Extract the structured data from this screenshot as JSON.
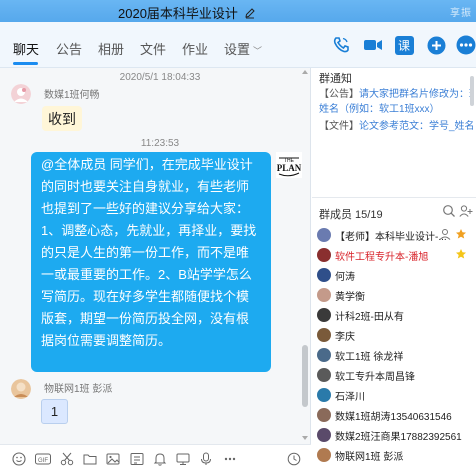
{
  "window": {
    "title": "2020届本科毕业设计",
    "top_right_faded": "享振"
  },
  "tabs": [
    {
      "label": "聊天",
      "active": true
    },
    {
      "label": "公告"
    },
    {
      "label": "相册"
    },
    {
      "label": "文件"
    },
    {
      "label": "作业"
    },
    {
      "label": "设置"
    }
  ],
  "toolbar": {
    "homework_icon_char": "课"
  },
  "chat": {
    "messages": [
      {
        "time": "2020/5/1 18:04:33",
        "sender": "数媒1班何畅",
        "text": "收到"
      },
      {
        "time": "11:23:53",
        "text": "@全体成员 同学们，在完成毕业设计的同时也要关注自身就业，有些老师也提到了一些好的建议分享给大家：1、调整心态，先就业，再择业，要找的只是人生的第一份工作，而不是唯一或最重要的工作。2、B站学学怎么写简历。现在好多学生都随便找个模版套，期望一份简历投全网，没有根据岗位需要调整简历。",
        "sticker_text": "THE PLAN"
      },
      {
        "sender": "物联网1班 彭派",
        "text": "1"
      }
    ]
  },
  "notice": {
    "title": "群通知",
    "lines": [
      {
        "tag": "【公告】",
        "text": "请大家把群名片修改为：班级+"
      },
      {
        "tag": "",
        "text": "姓名（例如：软工1班xxx）"
      },
      {
        "tag": "【文件】",
        "text": "论文参考范文：学号_姓名_毕..."
      }
    ]
  },
  "members": {
    "title": "群成员 15/19",
    "list": [
      {
        "name": "【老师】本科毕业设计-...",
        "color": "#222222",
        "avatar": "#6a7bb0"
      },
      {
        "name": "软件工程专升本-潘旭",
        "color": "#d8232a",
        "avatar": "#8a2f2f"
      },
      {
        "name": "何涛",
        "color": "#222222",
        "avatar": "#2f4f8a"
      },
      {
        "name": "黄学衡",
        "color": "#222222",
        "avatar": "#c49a8a"
      },
      {
        "name": "计科2班-田从有",
        "color": "#222222",
        "avatar": "#3a3a3a"
      },
      {
        "name": "李庆",
        "color": "#222222",
        "avatar": "#7a5a3a"
      },
      {
        "name": "软工1班 徐龙祥",
        "color": "#222222",
        "avatar": "#4a6a8a"
      },
      {
        "name": "软工专升本周昌锋",
        "color": "#222222",
        "avatar": "#5a5a5a"
      },
      {
        "name": "石泽川",
        "color": "#222222",
        "avatar": "#2a7aaa"
      },
      {
        "name": "数媒1班胡涛13540631546",
        "color": "#222222",
        "avatar": "#8a6a5a"
      },
      {
        "name": "数媒2班汪商果17882392561",
        "color": "#222222",
        "avatar": "#5a4a6a"
      },
      {
        "name": "物联网1班 彭派",
        "color": "#222222",
        "avatar": "#b07a50"
      }
    ]
  },
  "colors": {
    "accent": "#1a8cf0",
    "bubble": "#1daaf0",
    "titlebar": "#5aaaee"
  }
}
